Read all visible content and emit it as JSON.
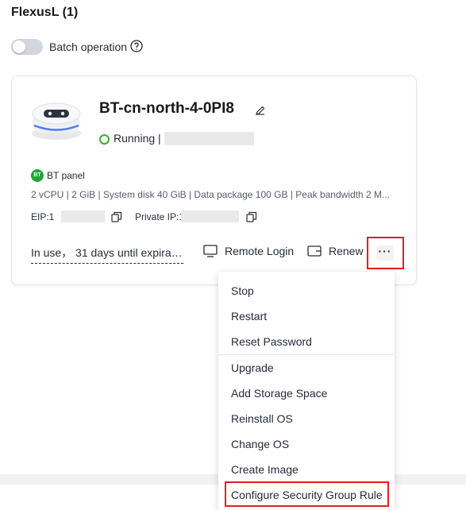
{
  "header": {
    "title": "FlexusL (1)"
  },
  "batch": {
    "label": "Batch operation",
    "enabled": false
  },
  "instance": {
    "name": "BT-cn-north-4-0PI8",
    "status": "Running",
    "status_separator": "|",
    "status_color": "#3dac32",
    "app_badge": "BT",
    "app_name": "BT panel",
    "specs": "2 vCPU | 2 GiB | System disk 40 GiB | Data package 100 GB | Peak bandwidth 2 M...",
    "eip_label": "EIP:1",
    "private_ip_label": "Private IP:1",
    "usage": "In use， 31 days until expirat..."
  },
  "actions": {
    "remote_login": "Remote Login",
    "renew": "Renew",
    "more": "···"
  },
  "menu": {
    "items": [
      "Stop",
      "Restart",
      "Reset Password",
      "Upgrade",
      "Add Storage Space",
      "Reinstall OS",
      "Change OS",
      "Create Image",
      "Configure Security Group Rule"
    ]
  },
  "colors": {
    "highlight": "#e02020",
    "bt_green": "#20a53a"
  }
}
